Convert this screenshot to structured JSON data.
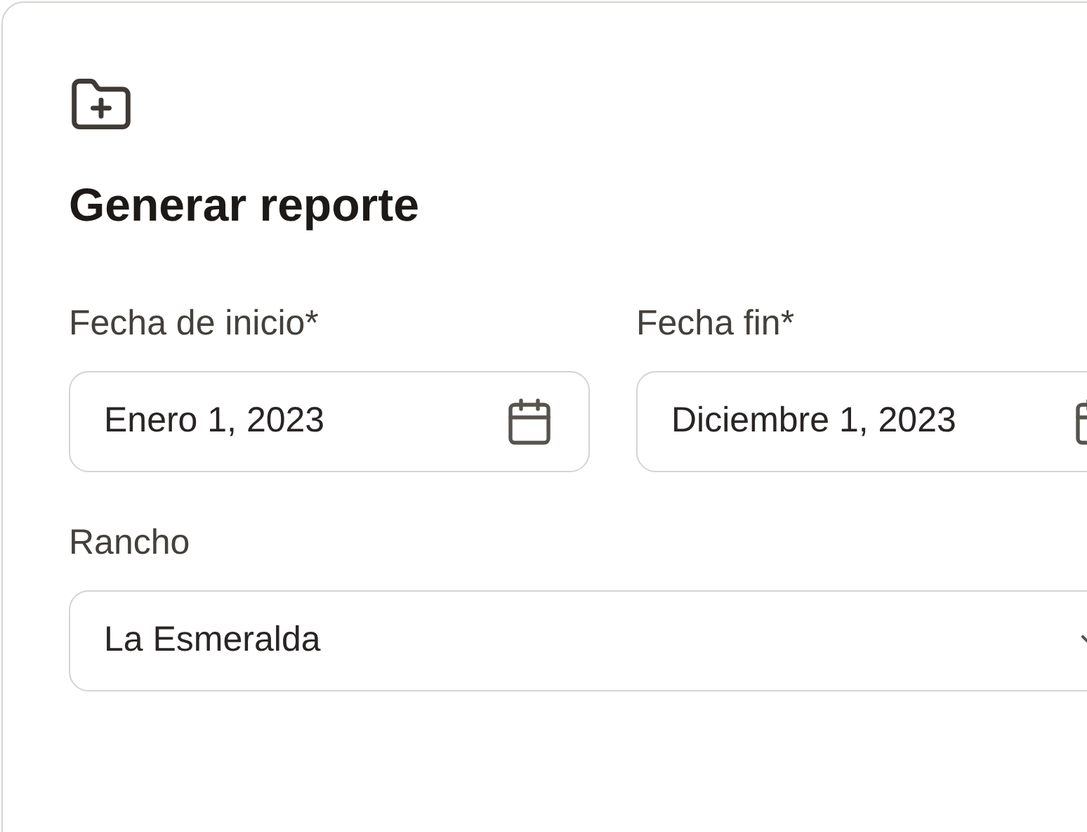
{
  "title": "Generar reporte",
  "date_fields": [
    {
      "label": "Fecha de inicio*",
      "value": "Enero 1, 2023"
    },
    {
      "label": "Fecha fin*",
      "value": "Diciembre 1, 2023"
    }
  ],
  "select": {
    "label": "Rancho",
    "value": "La Esmeralda"
  }
}
